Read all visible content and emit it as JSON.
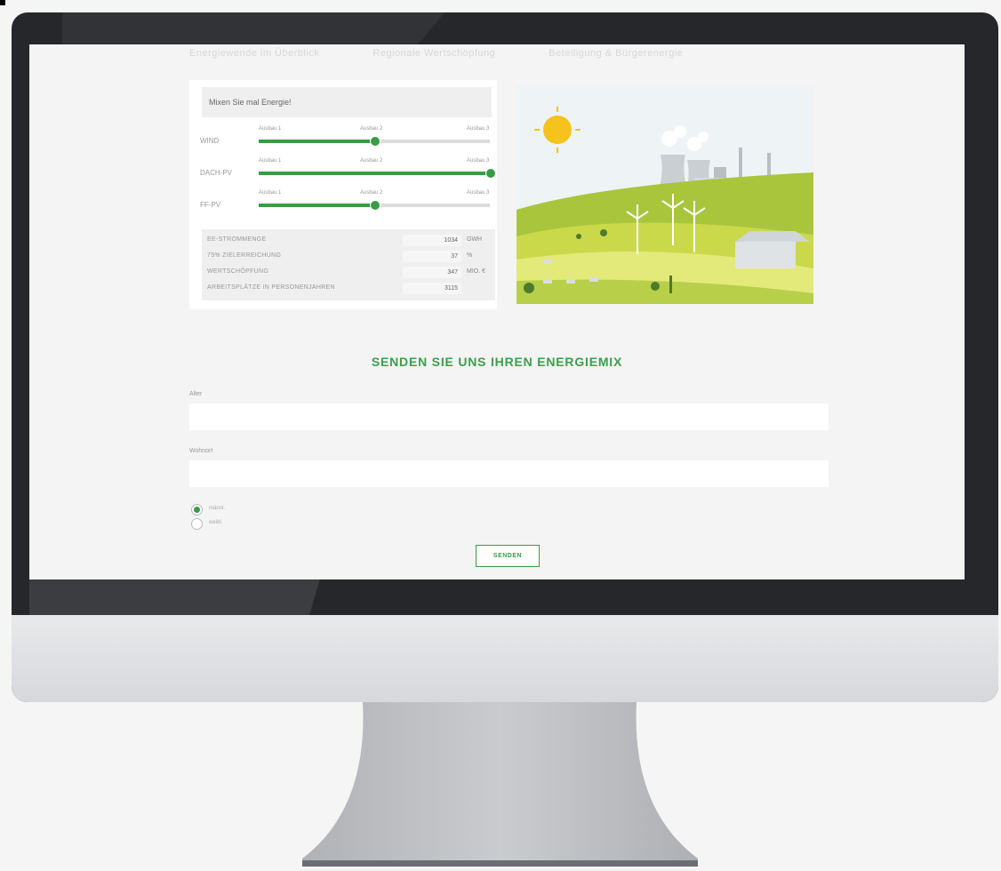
{
  "nav": {
    "items": [
      "Energiewende im Überblick",
      "Regionale Wertschöpfung",
      "Beteiligung & Bürgerenergie"
    ]
  },
  "mixer": {
    "heading": "Mixen Sie mal Energie!",
    "sliders": [
      {
        "label": "WIND",
        "ticks": [
          "Ausbau 1",
          "Ausbau 2",
          "Ausbau 3"
        ],
        "value": 0.5
      },
      {
        "label": "DACH-PV",
        "ticks": [
          "Ausbau 1",
          "Ausbau 2",
          "Ausbau 3"
        ],
        "value": 1.0
      },
      {
        "label": "FF-PV",
        "ticks": [
          "Ausbau 1",
          "Ausbau 2",
          "Ausbau 3"
        ],
        "value": 0.5
      }
    ],
    "stats": [
      {
        "label": "EE-STROMMENGE",
        "value": "1034",
        "unit": "GWH"
      },
      {
        "label": "75% ZIELERREICHUNG",
        "value": "37",
        "unit": "%"
      },
      {
        "label": "WERTSCHÖPFUNG",
        "value": "347",
        "unit": "MIO. €"
      },
      {
        "label": "ARBEITSPLÄTZE IN PERSONENJAHREN",
        "value": "3115",
        "unit": ""
      }
    ]
  },
  "form": {
    "title": "SENDEN SIE UNS IHREN ENERGIEMIX",
    "age_label": "Alter",
    "place_label": "Wohnort",
    "age_value": "",
    "place_value": "",
    "gender_options": [
      "männl.",
      "weibl."
    ],
    "submit_label": "SENDEN"
  },
  "colors": {
    "accent": "#3aa04a",
    "slider": "#3a9b45",
    "band": "#6db33f"
  }
}
